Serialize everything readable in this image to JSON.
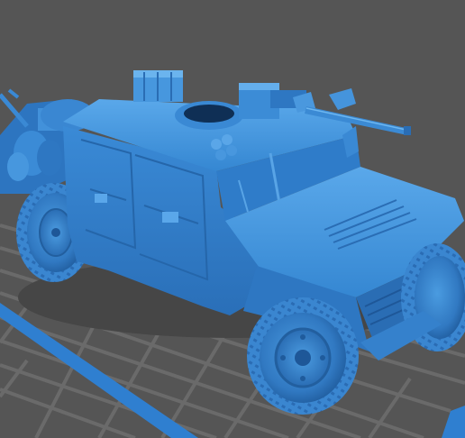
{
  "viewport": {
    "background": "#555555",
    "grid_color": "#6a6a6a",
    "plate_edge_color": "#2f7fd0"
  },
  "model": {
    "name": "humvee-with-turret-gun",
    "body_color": "#3d8fd8",
    "shadow_color": "#1d5a9a",
    "highlight_color": "#6cb6f0",
    "tire_color": "#3480cc"
  }
}
